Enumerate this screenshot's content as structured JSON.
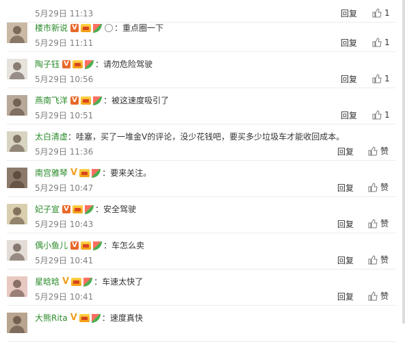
{
  "top_row": {
    "time": "5月29日 11:13",
    "reply_label": "回复",
    "like_count": "1"
  },
  "comments": [
    {
      "username": "楼市新说",
      "badges": [
        "v-red",
        "vip",
        "melon",
        "medal"
      ],
      "separator": "：",
      "text": "重点圈一下",
      "time": "5月29日 11:11",
      "reply_label": "回复",
      "like_label": "1",
      "avatar_color": "#c9b9a4"
    },
    {
      "username": "陶子钰",
      "badges": [
        "v-red",
        "vip",
        "melon"
      ],
      "separator": "：",
      "text": "请勿危险驾驶",
      "time": "5月29日 10:56",
      "reply_label": "回复",
      "like_label": "1",
      "avatar_color": "#e6e2dc"
    },
    {
      "username": "燕南飞洋",
      "badges": [
        "v-red",
        "vip",
        "melon"
      ],
      "separator": "：",
      "text": "被这速度吸引了",
      "time": "5月29日 10:51",
      "reply_label": "回复",
      "like_label": "1",
      "avatar_color": "#b7a89a"
    },
    {
      "username": "太白清虚",
      "badges": [],
      "separator": "：",
      "text": "哇塞，买了一堆金V的评论，没少花钱吧，要买多少垃圾车才能收回成本。",
      "time": "5月29日 11:36",
      "reply_label": "回复",
      "like_label": "赞",
      "avatar_color": "#d8d4c2"
    },
    {
      "username": "南宫雅琴",
      "badges": [
        "v-gold",
        "vip",
        "melon"
      ],
      "separator": "：",
      "text": "要来关注。",
      "time": "5月29日 10:47",
      "reply_label": "回复",
      "like_label": "赞",
      "avatar_color": "#8c7a6b"
    },
    {
      "username": "妃子宣",
      "badges": [
        "v-red",
        "vip",
        "melon"
      ],
      "separator": "：",
      "text": "安全驾驶",
      "time": "5月29日 10:43",
      "reply_label": "回复",
      "like_label": "赞",
      "avatar_color": "#d9cfae"
    },
    {
      "username": "偶小鱼儿",
      "badges": [
        "v-red",
        "vip",
        "melon"
      ],
      "separator": "：",
      "text": "车怎么卖",
      "time": "5月29日 10:41",
      "reply_label": "回复",
      "like_label": "赞",
      "avatar_color": "#e3dcd6"
    },
    {
      "username": "星晗晗",
      "badges": [
        "v-gold",
        "vip",
        "melon"
      ],
      "separator": "：",
      "text": "车速太快了",
      "time": "5月29日 10:41",
      "reply_label": "回复",
      "like_label": "赞",
      "avatar_color": "#e8c9c2"
    },
    {
      "username": "大熊Rita",
      "badges": [
        "v-gold",
        "vip",
        "melon"
      ],
      "separator": "：",
      "text": "速度真快",
      "time": "",
      "reply_label": "",
      "like_label": "",
      "avatar_color": "#b8a48f"
    }
  ],
  "colors": {
    "username": "#2a8a2a",
    "time": "#808080",
    "badge_red": "#e8692b",
    "badge_gold": "#f0a020"
  },
  "icons": {
    "like": "thumbs-up-icon",
    "reply": "reply-link"
  }
}
